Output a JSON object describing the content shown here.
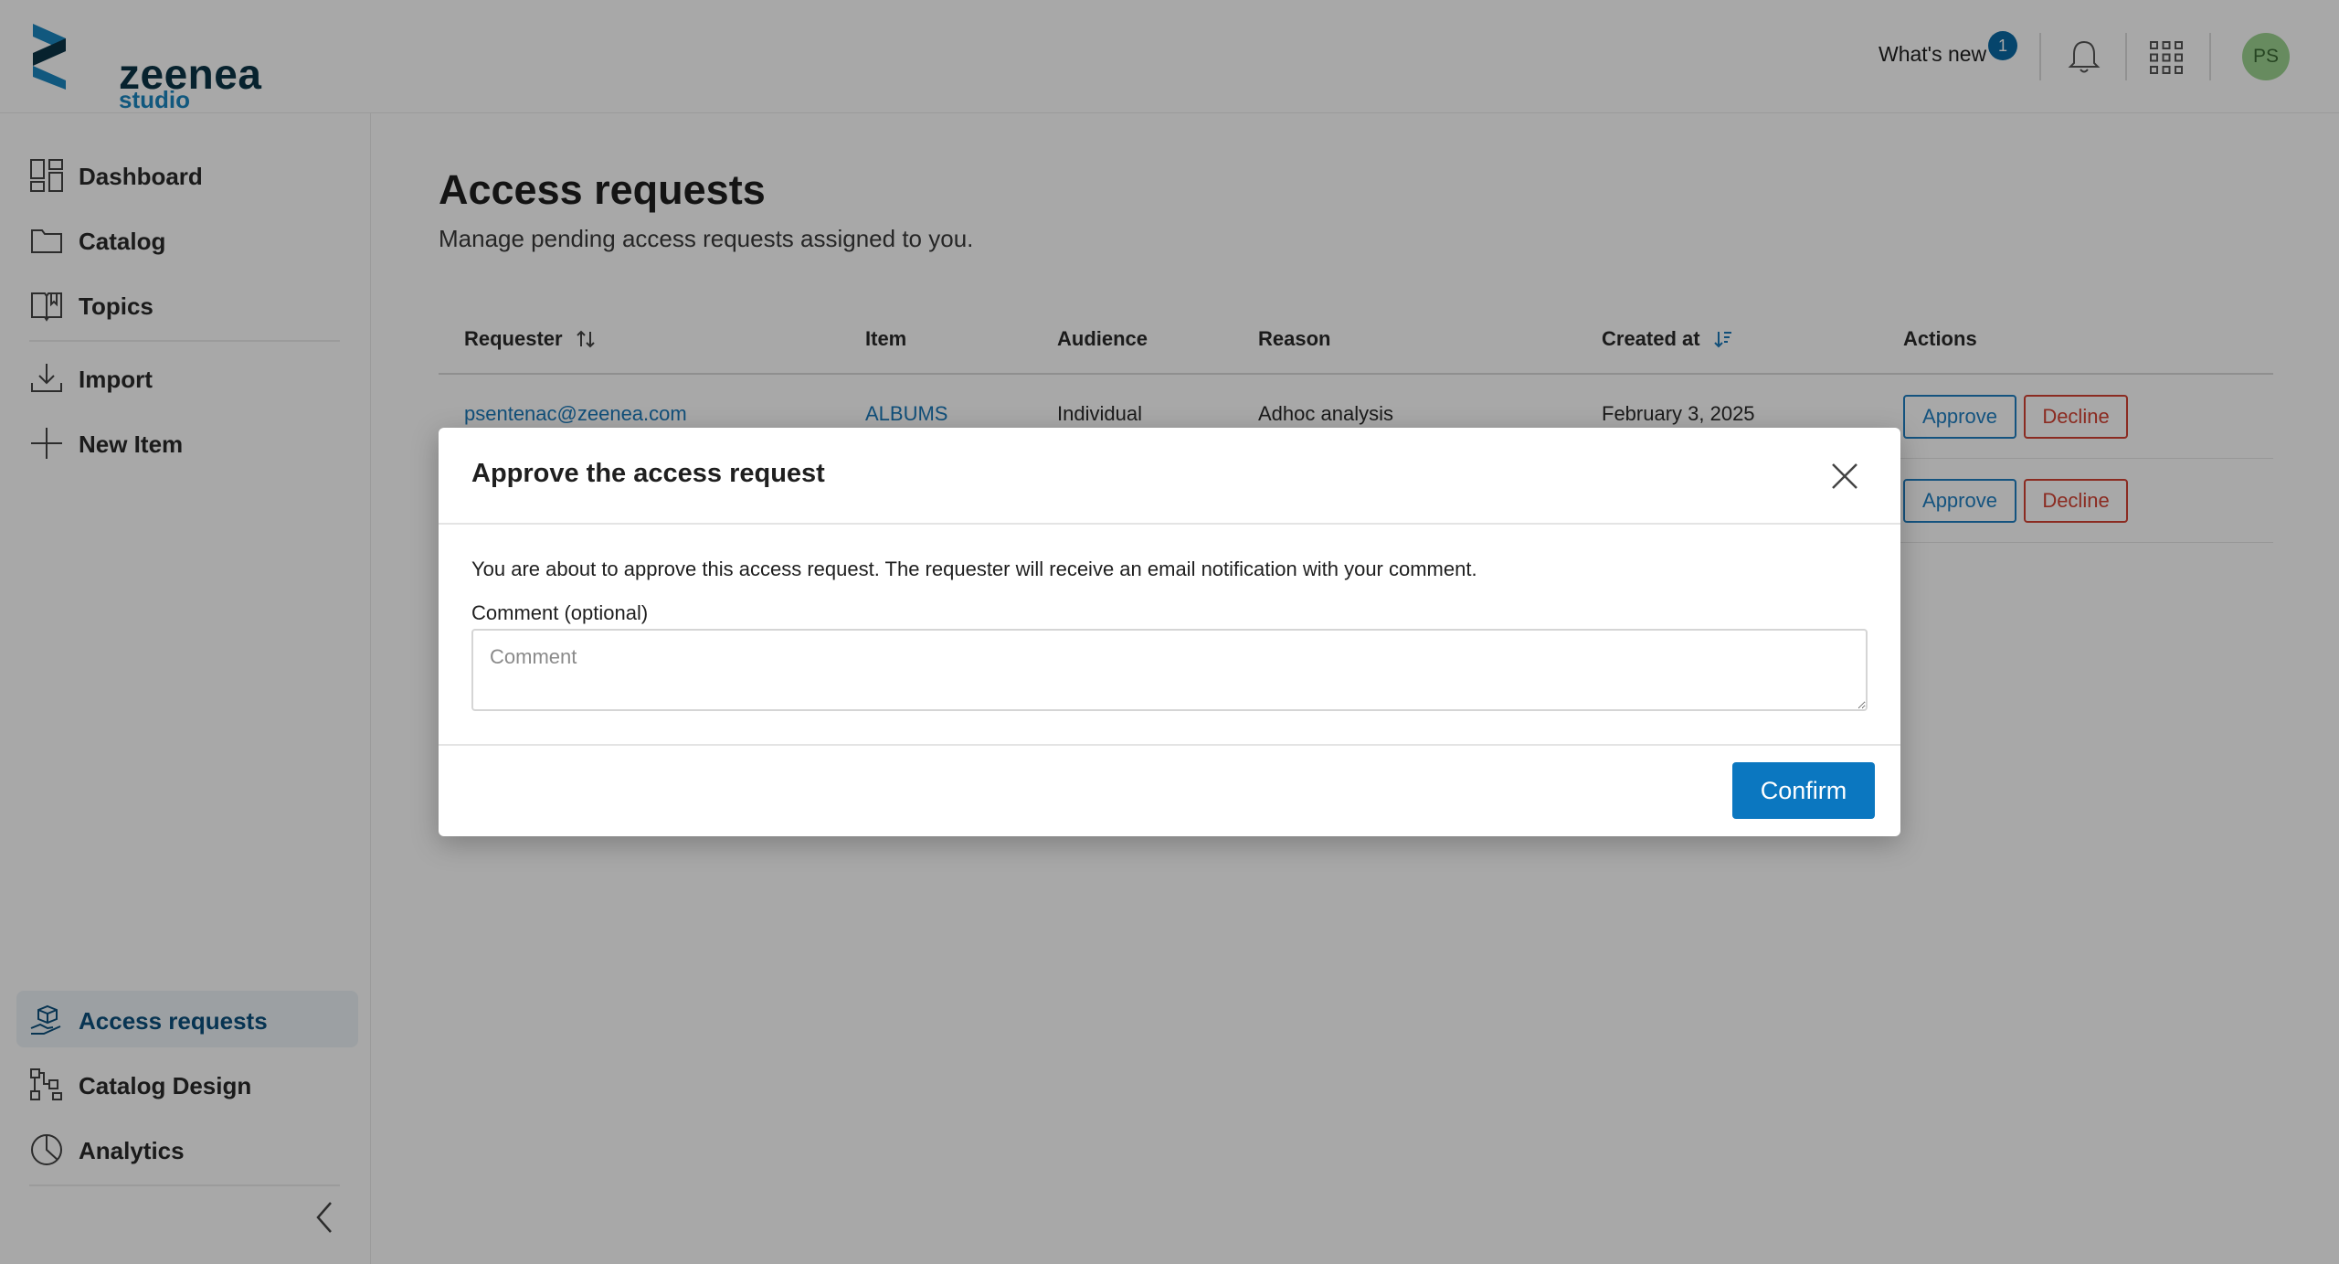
{
  "header": {
    "logo_name": "zeenea",
    "logo_sub": "studio",
    "whats_new_label": "What's new",
    "whats_new_count": "1",
    "user_initials": "PS",
    "icons": [
      "bell-icon",
      "apps-grid-icon"
    ]
  },
  "sidebar": {
    "items": [
      {
        "label": "Dashboard",
        "icon": "dashboard-icon"
      },
      {
        "label": "Catalog",
        "icon": "folder-icon"
      },
      {
        "label": "Topics",
        "icon": "book-icon"
      },
      {
        "label": "Import",
        "icon": "download-icon"
      },
      {
        "label": "New Item",
        "icon": "plus-icon"
      },
      {
        "label": "Access requests",
        "icon": "access-request-icon",
        "active": true
      },
      {
        "label": "Catalog Design",
        "icon": "catalog-design-icon"
      },
      {
        "label": "Analytics",
        "icon": "pie-chart-icon"
      }
    ]
  },
  "page": {
    "title": "Access requests",
    "subtitle": "Manage pending access requests assigned to you."
  },
  "table": {
    "columns": [
      "Requester",
      "Item",
      "Audience",
      "Reason",
      "Created at",
      "Actions"
    ],
    "rows": [
      {
        "requester": "psentenac@zeenea.com",
        "item": "ALBUMS",
        "audience": "Individual",
        "reason": "Adhoc analysis",
        "created_at": "February 3, 2025",
        "approve_label": "Approve",
        "decline_label": "Decline"
      },
      {
        "approve_label": "Approve",
        "decline_label": "Decline"
      }
    ]
  },
  "modal": {
    "title": "Approve the access request",
    "message": "You are about to approve this access request. The requester will receive an email notification with your comment.",
    "comment_label": "Comment (optional)",
    "comment_placeholder": "Comment",
    "comment_value": "",
    "confirm_label": "Confirm"
  },
  "colors": {
    "brand_dark": "#0b3446",
    "brand_blue": "#1a86c0",
    "link_blue": "#1a78b8",
    "primary_button": "#0b77c0",
    "decline_red": "#d34233",
    "overlay": "rgba(0,0,0,0.34)"
  }
}
